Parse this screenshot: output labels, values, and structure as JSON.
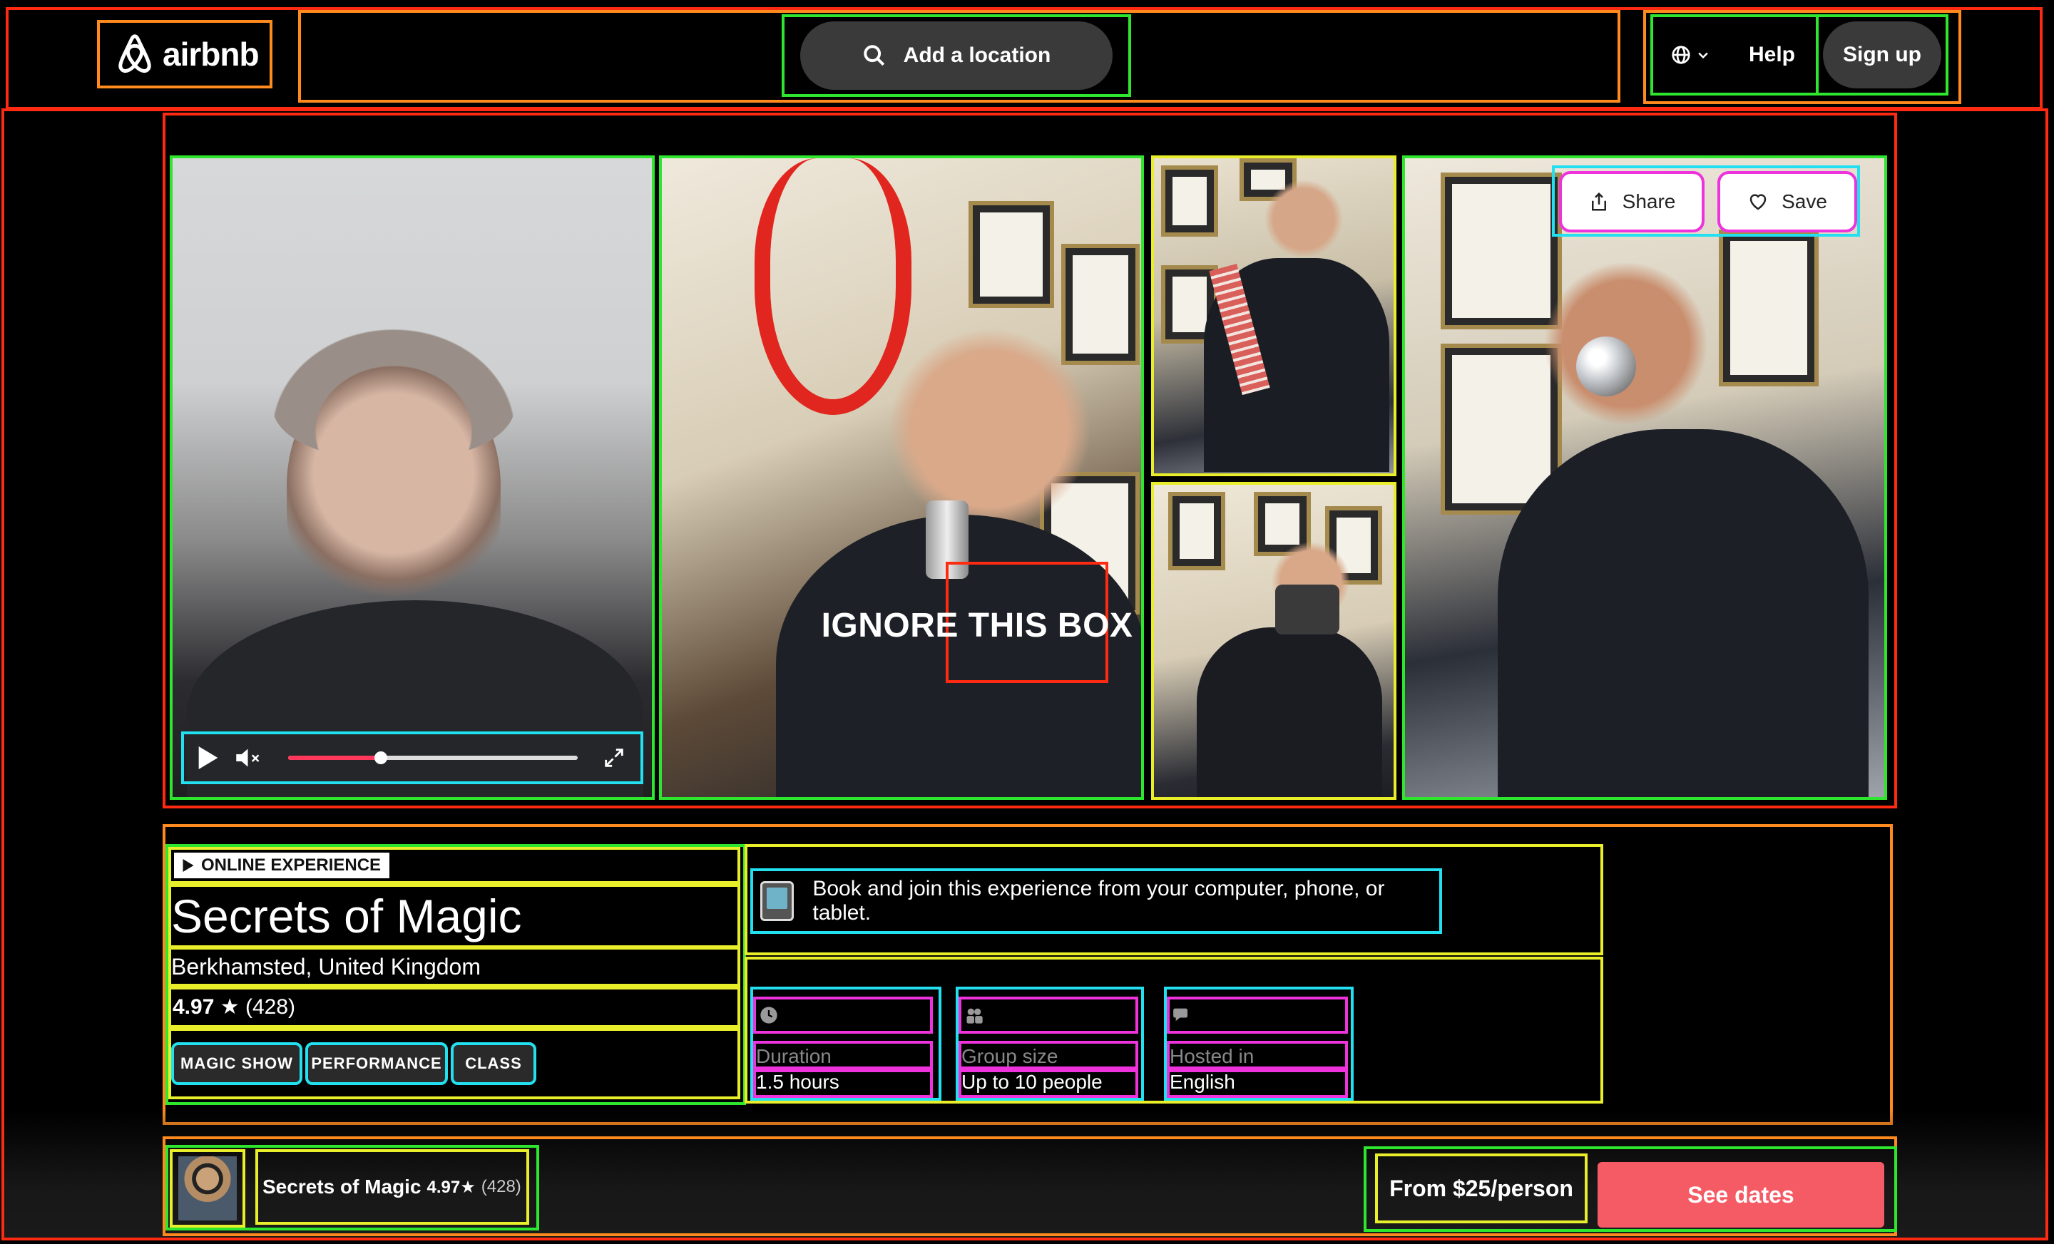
{
  "header": {
    "logo_text": "airbnb",
    "search_placeholder": "Add a location",
    "help_label": "Help",
    "signup_label": "Sign up"
  },
  "gallery": {
    "overlay_text": "IGNORE THIS BOX",
    "share_label": "Share",
    "save_label": "Save",
    "video_progress_fraction": 0.32
  },
  "experience": {
    "badge": "ONLINE EXPERIENCE",
    "title": "Secrets of Magic",
    "location": "Berkhamsted, United Kingdom",
    "rating_score": "4.97",
    "rating_count": "(428)",
    "tags": [
      "MAGIC SHOW",
      "PERFORMANCE",
      "CLASS"
    ],
    "device_note": "Book and join this experience from your computer, phone, or tablet.",
    "facts": [
      {
        "icon": "clock-icon",
        "label": "Duration",
        "value": "1.5 hours"
      },
      {
        "icon": "people-icon",
        "label": "Group size",
        "value": "Up to 10 people"
      },
      {
        "icon": "chat-icon",
        "label": "Hosted in",
        "value": "English"
      }
    ]
  },
  "bottom_bar": {
    "host_title": "Secrets of Magic",
    "host_score": "4.97★",
    "host_count": "(428)",
    "price": "From $25/person",
    "cta": "See dates"
  },
  "colors": {
    "accent": "#f45b65",
    "progress": "#ff385c",
    "pill_bg": "#3a3a3a"
  }
}
